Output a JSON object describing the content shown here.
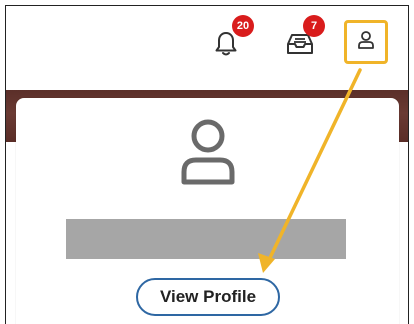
{
  "topbar": {
    "notifications_icon": "bell-icon",
    "notifications_count": "20",
    "inbox_icon": "inbox-icon",
    "inbox_count": "7",
    "profile_icon": "user-icon"
  },
  "profile_panel": {
    "avatar_icon": "user-icon",
    "view_profile_label": "View Profile"
  },
  "colors": {
    "badge": "#d91c1c",
    "highlight": "#f0b429",
    "band": "#5b2f29",
    "button_outline": "#2e67a3"
  }
}
